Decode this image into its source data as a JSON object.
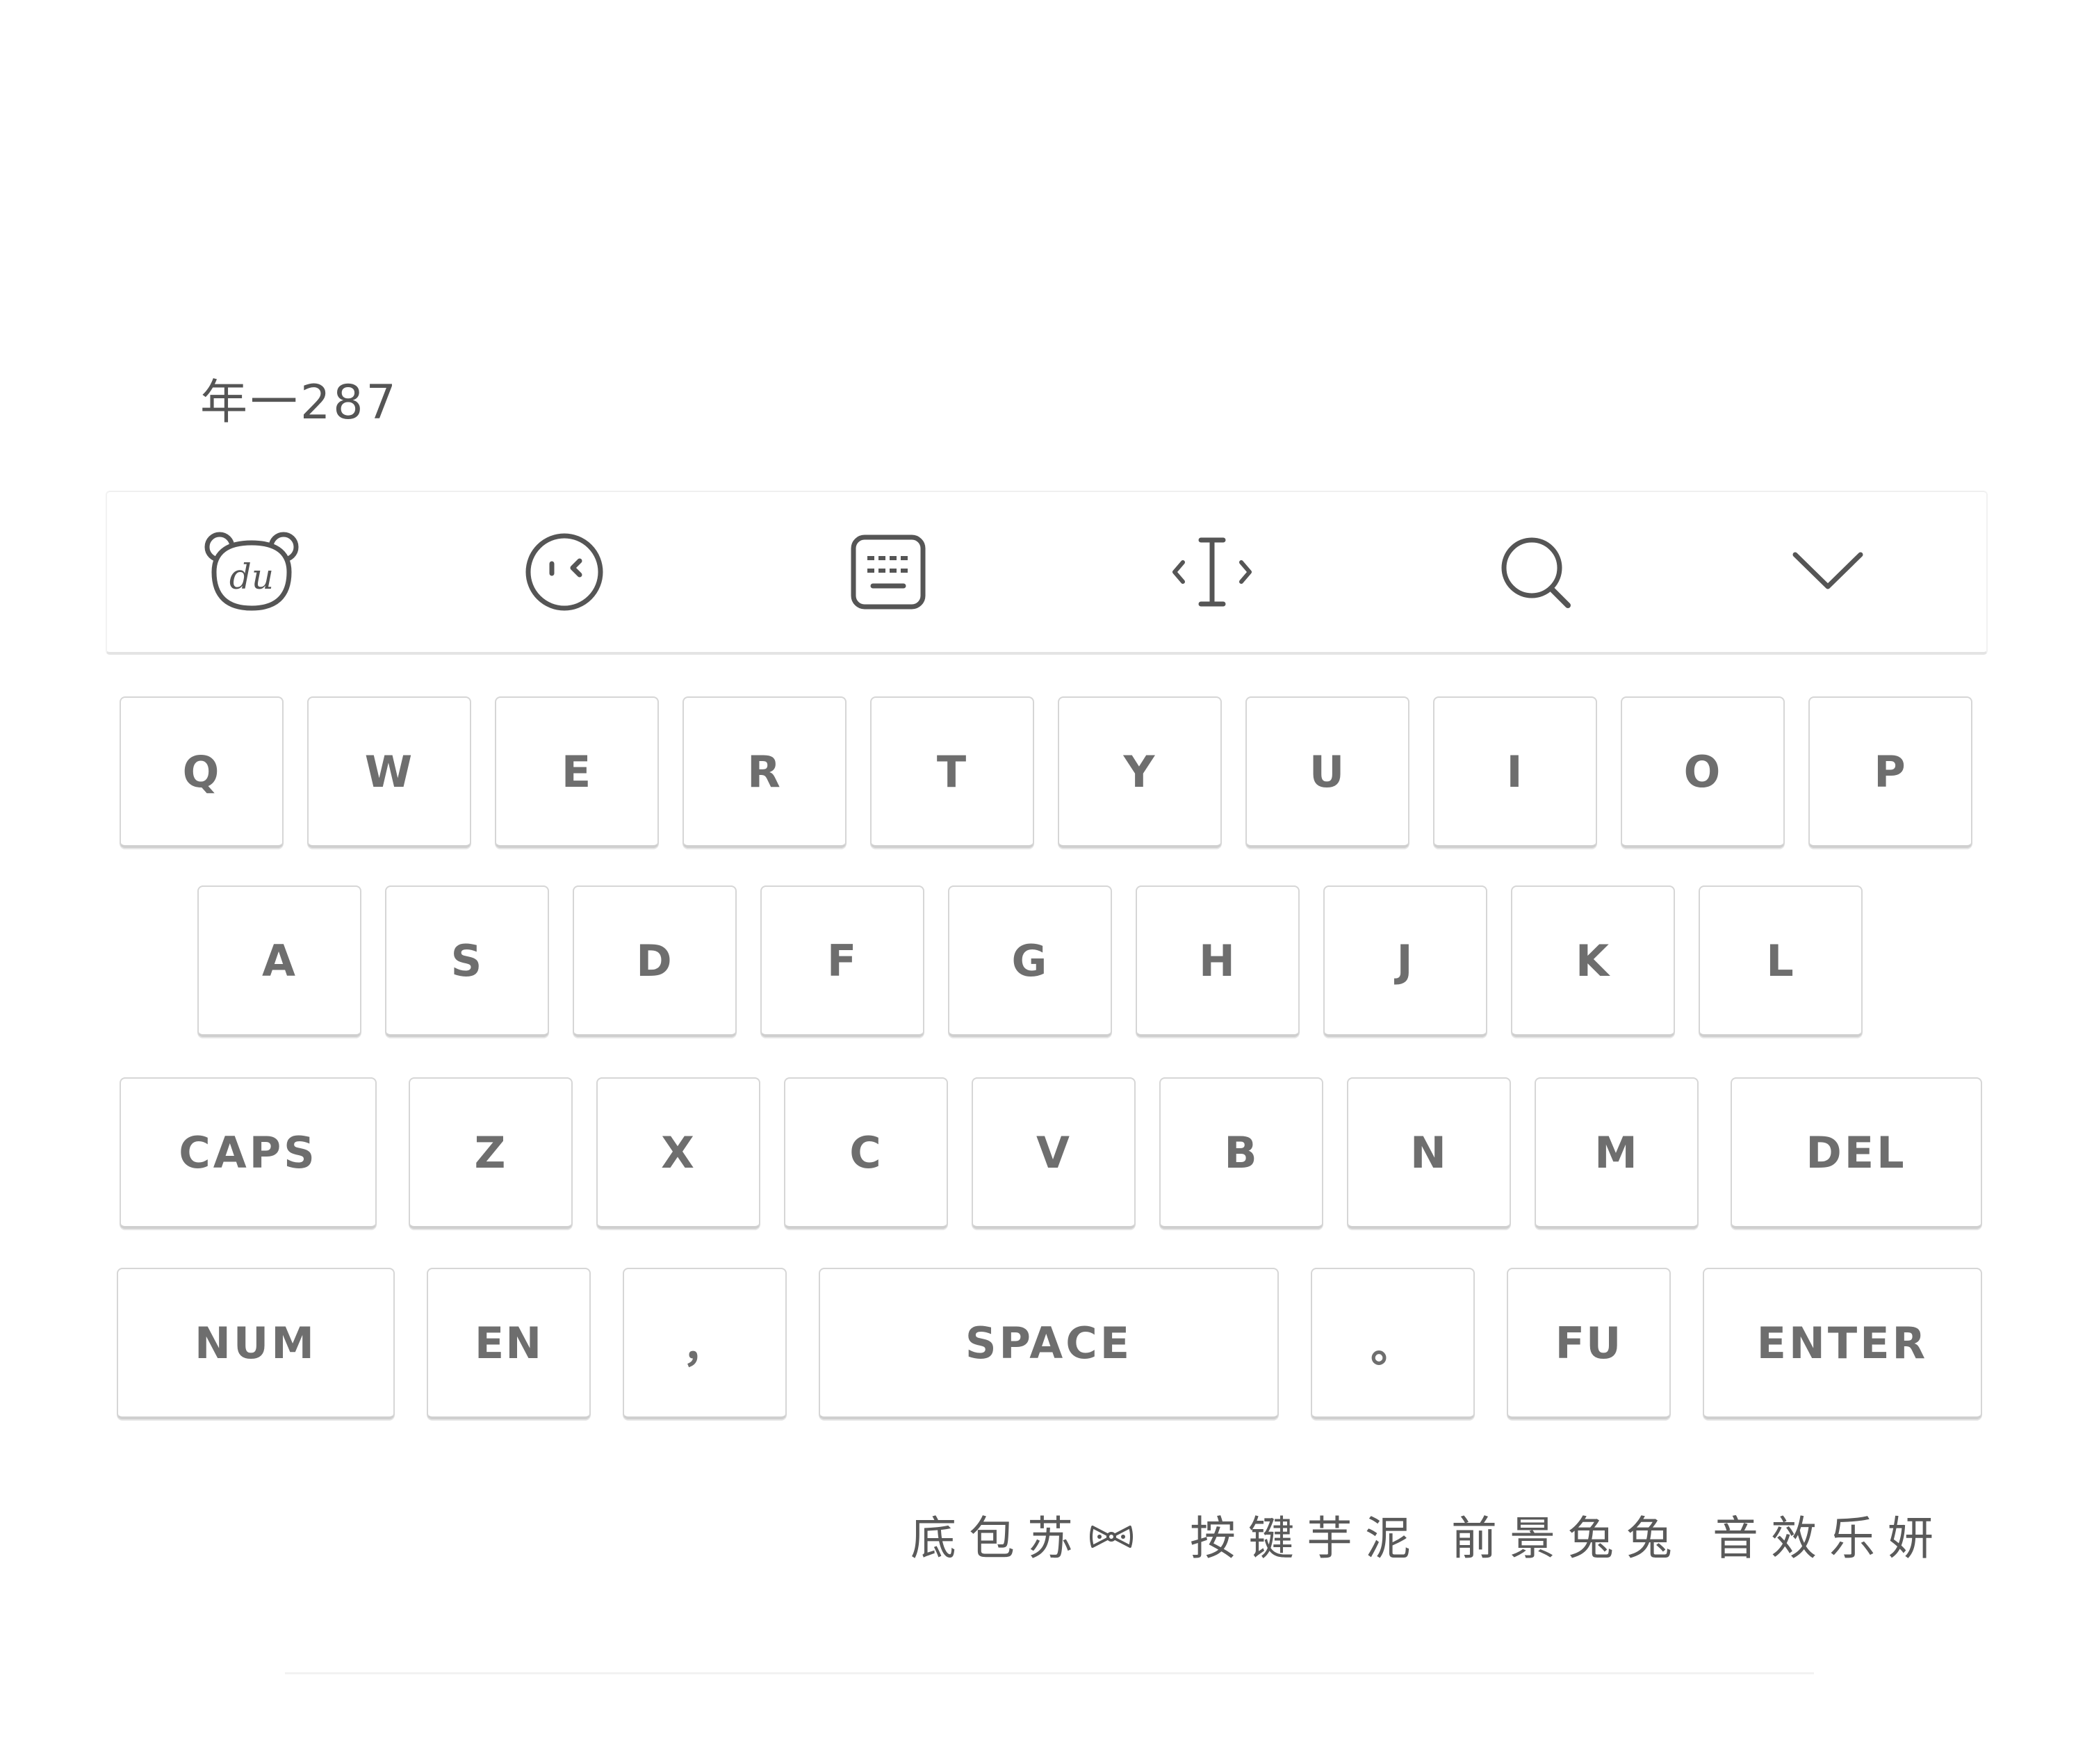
{
  "header": {
    "text": "年一287"
  },
  "toolbar": {
    "icons": [
      {
        "name": "du-bear-logo-icon"
      },
      {
        "name": "emoji-face-icon"
      },
      {
        "name": "keyboard-icon"
      },
      {
        "name": "cursor-move-icon"
      },
      {
        "name": "search-icon"
      },
      {
        "name": "chevron-down-icon"
      }
    ]
  },
  "keyboard": {
    "row1": [
      "Q",
      "W",
      "E",
      "R",
      "T",
      "Y",
      "U",
      "I",
      "O",
      "P"
    ],
    "row2": [
      "A",
      "S",
      "D",
      "F",
      "G",
      "H",
      "J",
      "K",
      "L"
    ],
    "row3": [
      "CAPS",
      "Z",
      "X",
      "C",
      "V",
      "B",
      "N",
      "M",
      "DEL"
    ],
    "row4": [
      "NUM",
      "EN",
      "，",
      "SPACE",
      "。",
      "FU",
      "ENTER"
    ]
  },
  "credits": {
    "group1": "底包苏",
    "group1_icon": "bow-tie-icon",
    "group2": "按键芋泥",
    "group3": "前景兔兔",
    "group4": "音效乐妍"
  },
  "colors": {
    "key_text": "#6e6e6e",
    "key_border": "#d6d6d6",
    "icon_stroke": "#555555",
    "background": "#ffffff"
  }
}
